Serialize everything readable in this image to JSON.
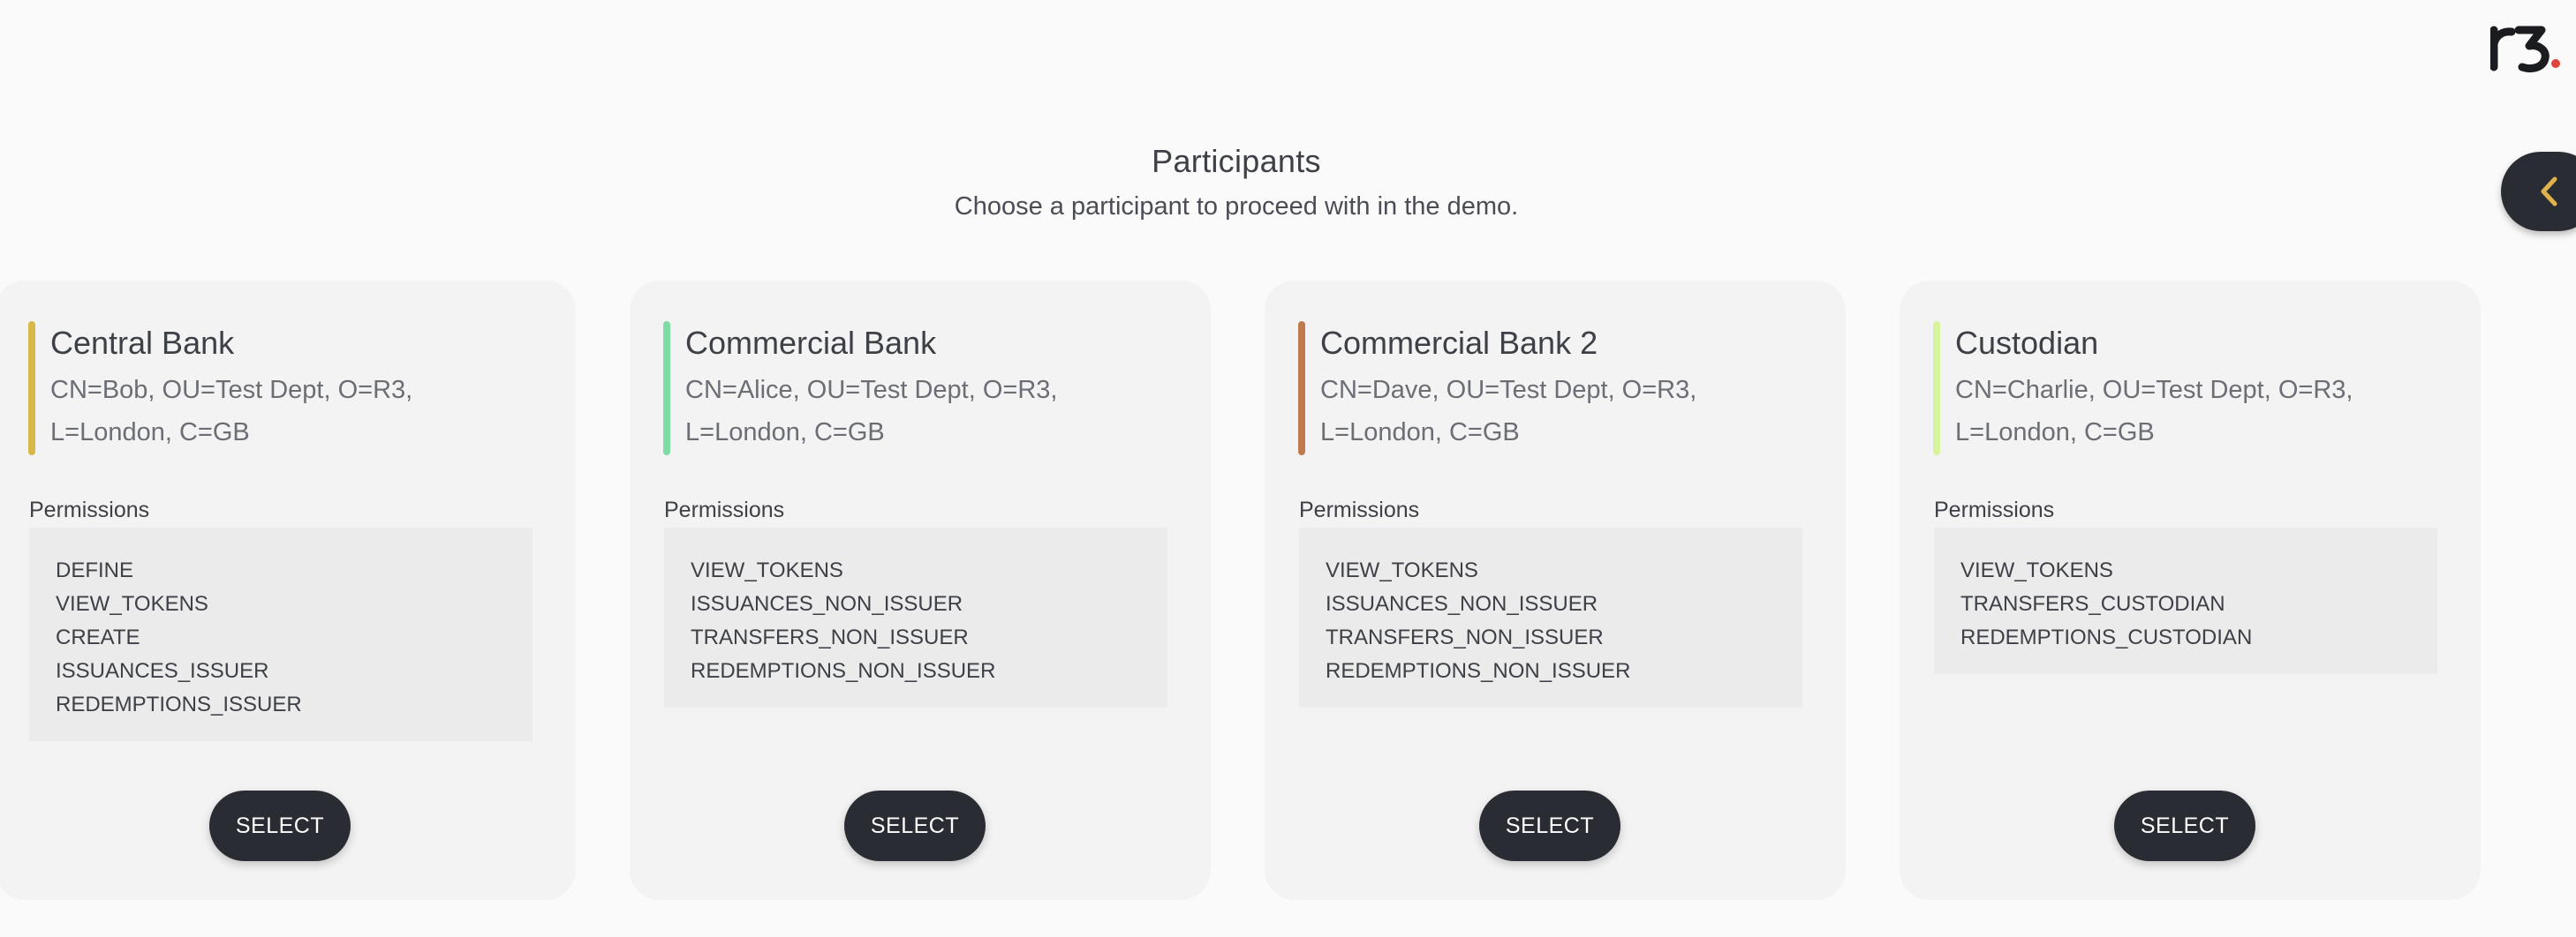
{
  "header": {
    "title": "Participants",
    "subtitle": "Choose a participant to proceed with in the demo."
  },
  "logo": {
    "text": "r3"
  },
  "side_tab": {
    "icon": "chevron-left-icon",
    "color": "#e0b24a"
  },
  "permissions_label": "Permissions",
  "select_label": "SELECT",
  "participants": [
    {
      "name": "Central Bank",
      "dn": "CN=Bob, OU=Test Dept, O=R3, L=London, C=GB",
      "accent": "#d9b84a",
      "permissions": [
        "DEFINE",
        "VIEW_TOKENS",
        "CREATE",
        "ISSUANCES_ISSUER",
        "REDEMPTIONS_ISSUER"
      ]
    },
    {
      "name": "Commercial Bank",
      "dn": "CN=Alice, OU=Test Dept, O=R3, L=London, C=GB",
      "accent": "#7fdca5",
      "permissions": [
        "VIEW_TOKENS",
        "ISSUANCES_NON_ISSUER",
        "TRANSFERS_NON_ISSUER",
        "REDEMPTIONS_NON_ISSUER"
      ]
    },
    {
      "name": "Commercial Bank 2",
      "dn": "CN=Dave, OU=Test Dept, O=R3, L=London, C=GB",
      "accent": "#c07a4f",
      "permissions": [
        "VIEW_TOKENS",
        "ISSUANCES_NON_ISSUER",
        "TRANSFERS_NON_ISSUER",
        "REDEMPTIONS_NON_ISSUER"
      ]
    },
    {
      "name": "Custodian",
      "dn": "CN=Charlie, OU=Test Dept, O=R3, L=London, C=GB",
      "accent": "#d4f59a",
      "permissions": [
        "VIEW_TOKENS",
        "TRANSFERS_CUSTODIAN",
        "REDEMPTIONS_CUSTODIAN"
      ]
    }
  ]
}
